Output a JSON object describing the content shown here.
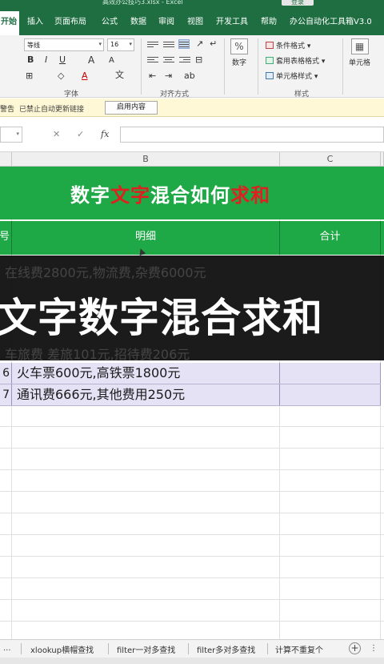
{
  "window": {
    "title": "高效办公技巧3.xlsx - Excel",
    "login_label": "登录"
  },
  "ribbon_tabs": [
    "开始",
    "插入",
    "页面布局",
    "公式",
    "数据",
    "审阅",
    "视图",
    "开发工具",
    "帮助",
    "办公自动化工具箱V3.0"
  ],
  "ribbon": {
    "font_name": "等线",
    "font_size": "16",
    "font_group": "字体",
    "align_group": "对齐方式",
    "number_label": "数字",
    "styles_group": "样式",
    "cells_label": "单元格",
    "conditional_format": "条件格式",
    "table_format": "套用表格格式",
    "cell_styles": "单元格样式",
    "grow_font": "A",
    "shrink_font": "A",
    "bold": "B",
    "italic": "I",
    "underline": "U",
    "font_color": "A",
    "wen": "文"
  },
  "message_bar": {
    "label": "警告",
    "text": "已禁止自动更新链接",
    "button": "启用内容"
  },
  "formula_bar": {
    "cancel": "✕",
    "confirm": "✓",
    "fx": "fx"
  },
  "columns": [
    "B",
    "C"
  ],
  "sheet": {
    "title_parts": [
      {
        "text": "数字",
        "red": false
      },
      {
        "text": "文字",
        "red": true
      },
      {
        "text": "混合如何",
        "red": false
      },
      {
        "text": "求和",
        "red": true
      }
    ],
    "headers": {
      "index": "号",
      "detail": "明细",
      "total": "合计"
    },
    "rows": [
      {
        "index": "6",
        "detail": "火车票600元,高铁票1800元",
        "total": ""
      },
      {
        "index": "7",
        "detail": "通讯费666元,其他费用250元",
        "total": ""
      }
    ]
  },
  "overlay": {
    "caption": "文字数字混合求和",
    "ghost_top": "在线费2800元,物流费,杂费6000元",
    "ghost_bottom": "车旅费 差旅101元,招待费206元"
  },
  "sheet_tabs": [
    "xlookup横帽查找",
    "filter一对多查找",
    "filter多对多查找",
    "计算不重复个"
  ],
  "sheet_tabs_ellipsis": "...",
  "add_sheet": "+",
  "more_tabs": "⋮"
}
